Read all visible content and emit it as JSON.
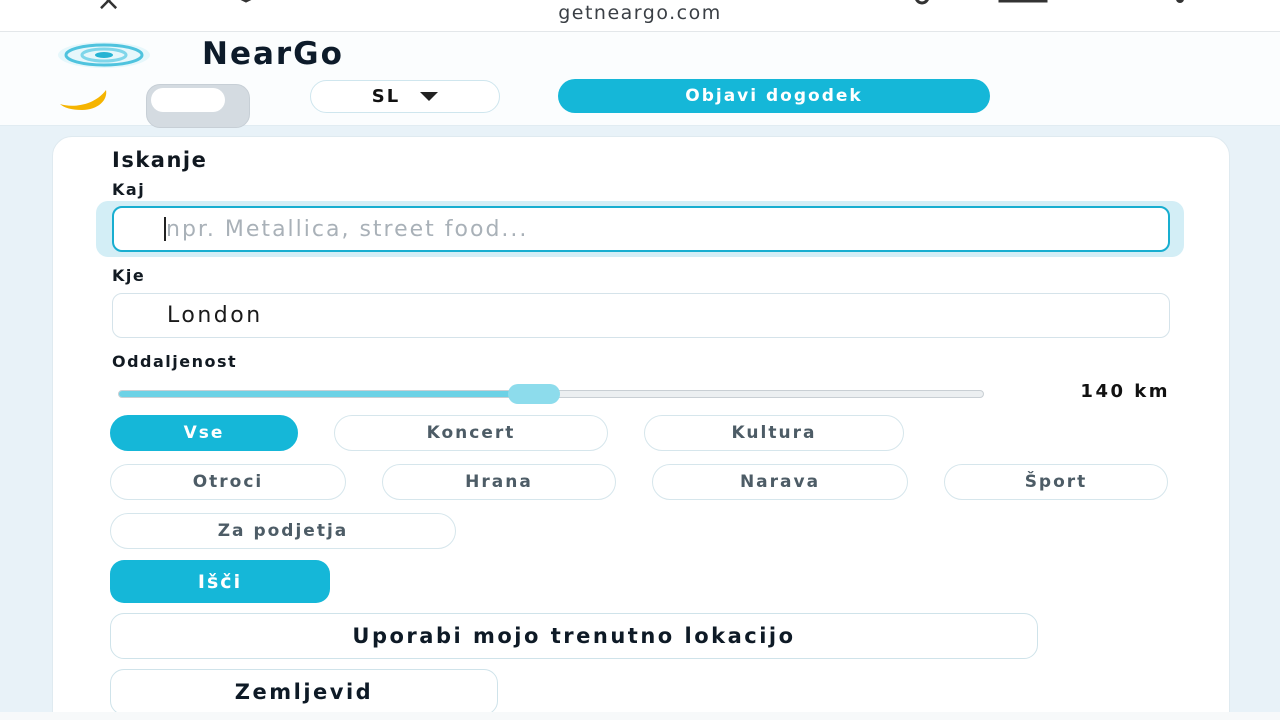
{
  "browser": {
    "url": "getneargo.com"
  },
  "header": {
    "brand": "NearGo",
    "language": "SL",
    "publish_label": "Objavi dogodek"
  },
  "search": {
    "title": "Iskanje",
    "what_label": "Kaj",
    "what_placeholder": "npr. Metallica, street food...",
    "what_value": "",
    "where_label": "Kje",
    "where_value": "London",
    "distance_label": "Oddaljenost",
    "distance_value": "140 km",
    "distance_fraction": 0.48,
    "categories": [
      "Vse",
      "Koncert",
      "Kultura",
      "Otroci",
      "Hrana",
      "Narava",
      "Šport",
      "Za podjetja"
    ],
    "active_category": "Vse",
    "search_label": "Išči",
    "location_label": "Uporabi mojo trenutno lokacijo",
    "map_label": "Zemljevid"
  },
  "colors": {
    "accent": "#15b7d8",
    "accent_light": "#6cd2e6",
    "text": "#0f1b2a"
  }
}
